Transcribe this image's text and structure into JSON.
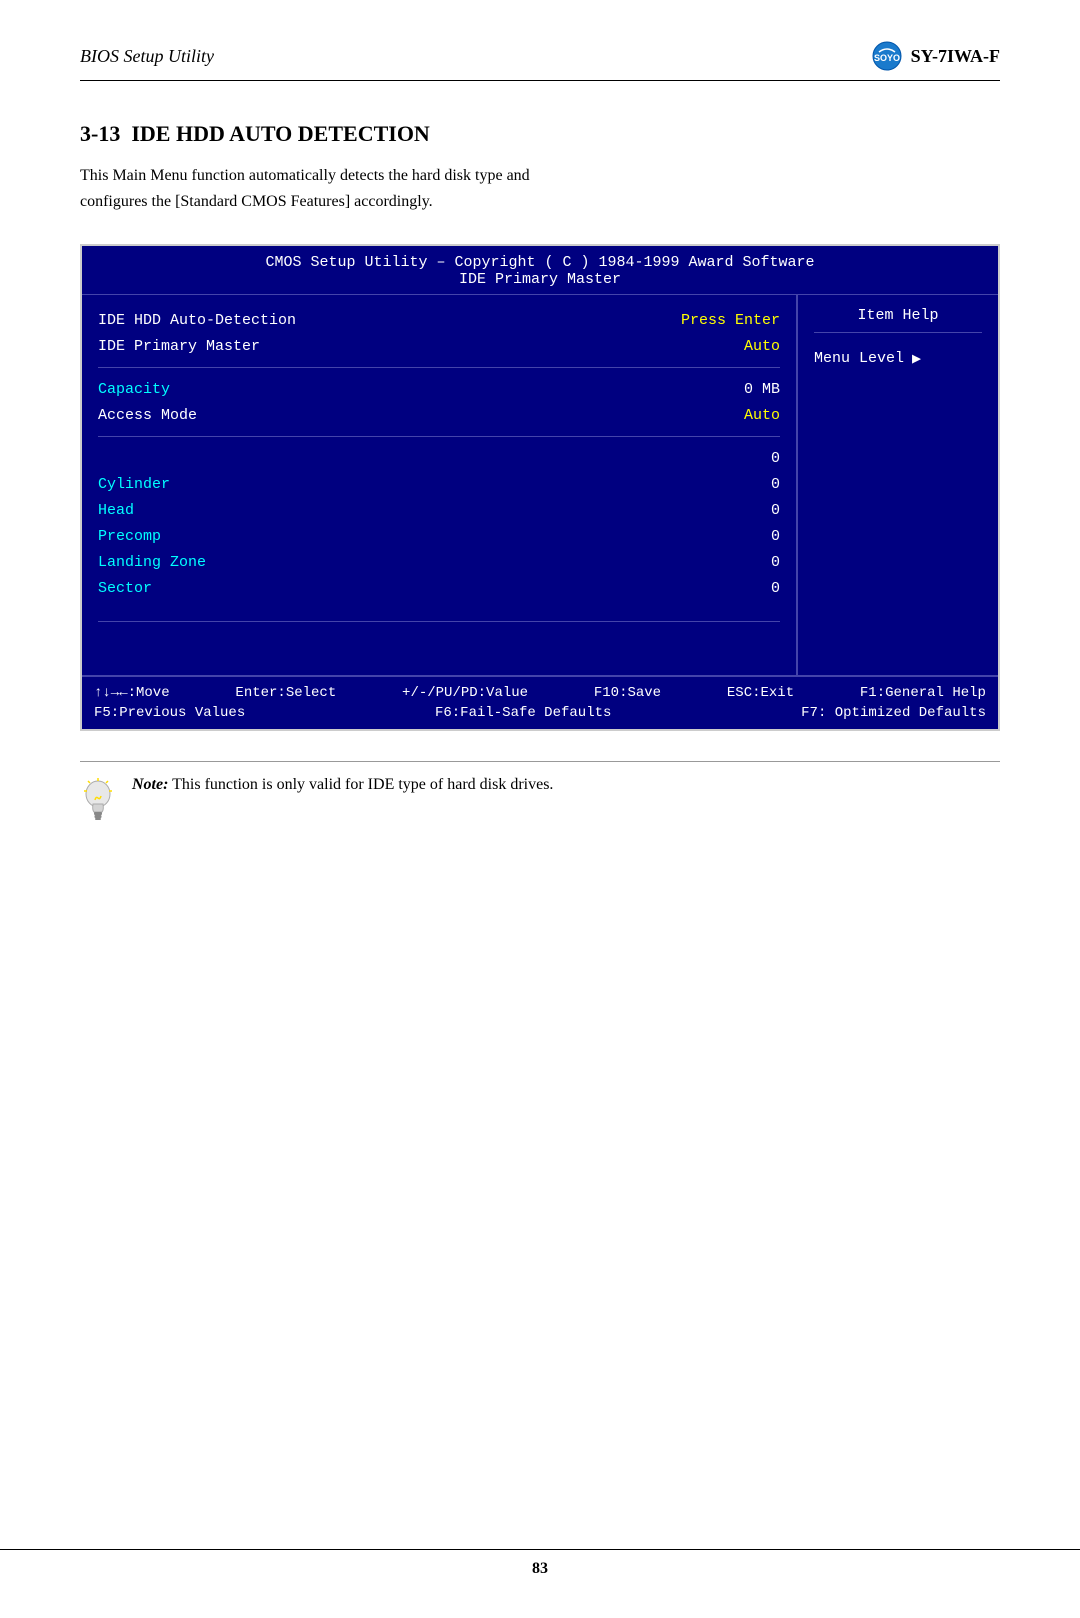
{
  "header": {
    "title": "BIOS Setup Utility",
    "product": "SY-7IWA-F"
  },
  "section": {
    "number": "3-13",
    "title": "IDE HDD AUTO DETECTION",
    "description_line1": "This Main Menu function automatically detects the hard disk type and",
    "description_line2": "configures the [Standard CMOS Features] accordingly."
  },
  "bios": {
    "title_line1": "CMOS Setup Utility – Copyright ( C ) 1984-1999 Award Software",
    "title_line2": "IDE Primary Master",
    "rows": [
      {
        "label": "IDE HDD Auto-Detection",
        "value": "Press Enter",
        "label_color": "white",
        "value_color": "yellow"
      },
      {
        "label": "IDE Primary Master",
        "value": "Auto",
        "label_color": "white",
        "value_color": "yellow"
      },
      {
        "label": "Capacity",
        "value": "0 MB",
        "label_color": "cyan",
        "value_color": "white"
      },
      {
        "label": "Access Mode",
        "value": "Auto",
        "label_color": "white",
        "value_color": "yellow"
      },
      {
        "label": "",
        "value": "0",
        "label_color": "white",
        "value_color": "white"
      },
      {
        "label": "Cylinder",
        "value": "0",
        "label_color": "cyan",
        "value_color": "white"
      },
      {
        "label": "Head",
        "value": "0",
        "label_color": "cyan",
        "value_color": "white"
      },
      {
        "label": "Precomp",
        "value": "0",
        "label_color": "cyan",
        "value_color": "white"
      },
      {
        "label": "Landing Zone",
        "value": "0",
        "label_color": "cyan",
        "value_color": "white"
      },
      {
        "label": "Sector",
        "value": "0",
        "label_color": "cyan",
        "value_color": "white"
      }
    ],
    "sidebar": {
      "item_help": "Item Help",
      "menu_level": "Menu Level",
      "menu_level_arrow": "▶"
    },
    "nav": {
      "row1_left": "↑↓→←:Move",
      "row1_mid1": "Enter:Select",
      "row1_mid2": "+/-/PU/PD:Value",
      "row1_mid3": "F10:Save",
      "row1_right1": "ESC:Exit",
      "row1_right2": "F1:General Help",
      "row2_left": "F5:Previous Values",
      "row2_mid": "F6:Fail-Safe Defaults",
      "row2_right": "F7: Optimized Defaults"
    }
  },
  "note": {
    "bold_part": "Note:",
    "text": " This function is only valid for IDE type of hard disk drives."
  },
  "footer": {
    "page_number": "83"
  }
}
